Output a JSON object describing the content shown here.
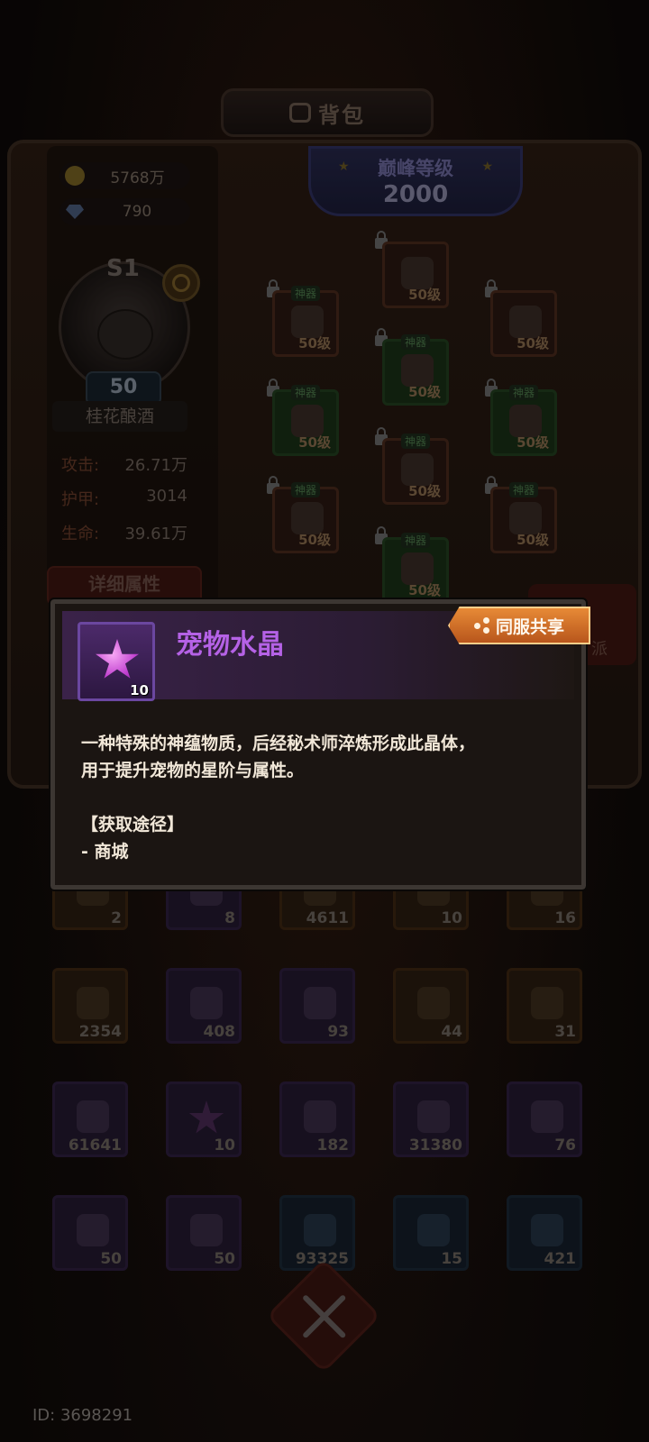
{
  "header": {
    "title": "背包"
  },
  "currencies": [
    {
      "icon": "gold-coin-icon",
      "value": "5768万"
    },
    {
      "icon": "diamond-icon",
      "value": "790"
    }
  ],
  "pet": {
    "rank": "S1",
    "level": "50",
    "name": "桂花酿酒",
    "stats": [
      {
        "label": "攻击:",
        "value": "26.71万"
      },
      {
        "label": "护甲:",
        "value": "3014"
      },
      {
        "label": "生命:",
        "value": "39.61万"
      }
    ],
    "detail_button": "详细属性"
  },
  "peak": {
    "label": "巅峰等级",
    "value": "2000"
  },
  "equipment_slots": [
    {
      "level": "50级",
      "tag": ""
    },
    {
      "level": "50级",
      "tag": "神器"
    },
    {
      "level": "50级",
      "tag": ""
    },
    {
      "level": "50级",
      "tag": "神器"
    },
    {
      "level": "50级",
      "tag": "神器"
    },
    {
      "level": "50级",
      "tag": "神器"
    },
    {
      "level": "50级",
      "tag": "神器"
    },
    {
      "level": "50级",
      "tag": "神器"
    },
    {
      "level": "50级",
      "tag": "神器"
    },
    {
      "level": "50级",
      "tag": ""
    },
    {
      "level": "50级",
      "tag": "神器"
    }
  ],
  "side_button_partial": "派",
  "popup": {
    "item_name": "宠物水晶",
    "item_count": "10",
    "share_button": "同服共享",
    "description_line1": "一种特殊的神蕴物质，后经秘术师淬炼形成此晶体，",
    "description_line2": "用于提升宠物的星阶与属性。",
    "source_title": "【获取途径】",
    "source_item": "- 商城"
  },
  "inventory": [
    [
      "2",
      "8",
      "4611",
      "10",
      "16"
    ],
    [
      "2354",
      "408",
      "93",
      "44",
      "31"
    ],
    [
      "61641",
      "10",
      "182",
      "31380",
      "76"
    ],
    [
      "50",
      "50",
      "93325",
      "15",
      "421"
    ]
  ],
  "footer": {
    "player_id": "ID: 3698291"
  }
}
